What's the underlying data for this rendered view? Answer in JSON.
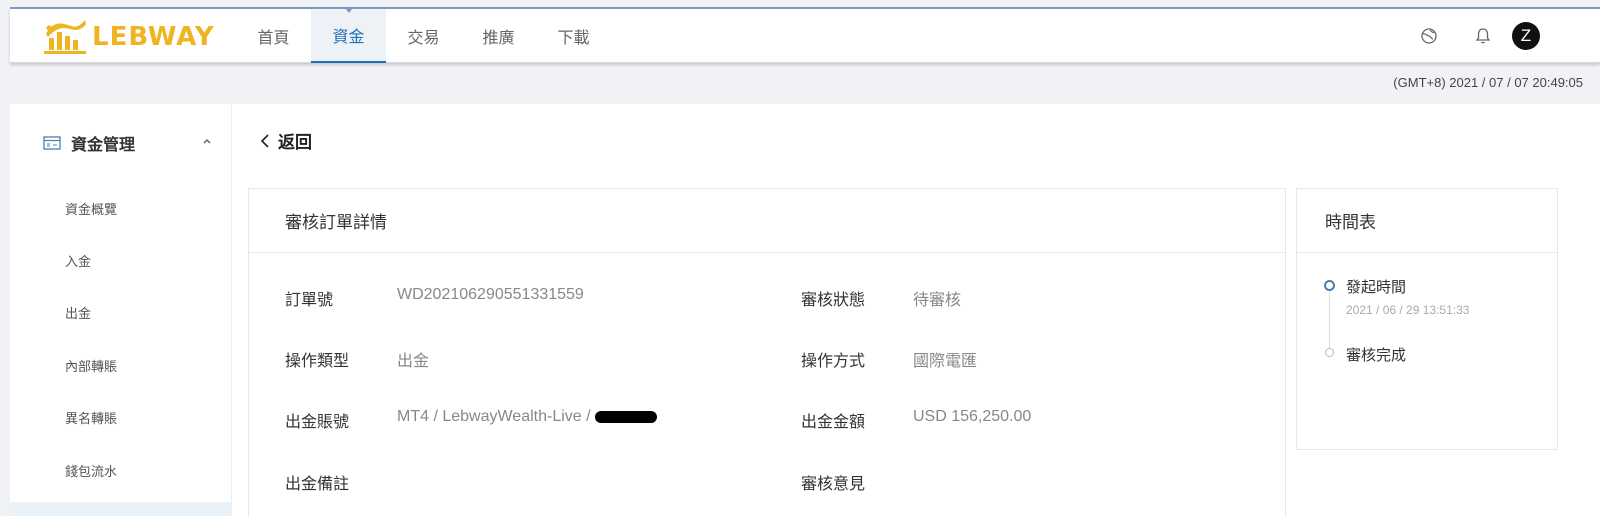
{
  "brand": {
    "name": "LEBWAY",
    "color": "#f0b322"
  },
  "nav": {
    "items": [
      {
        "label": "首頁",
        "active": false
      },
      {
        "label": "資金",
        "active": true
      },
      {
        "label": "交易",
        "active": false
      },
      {
        "label": "推廣",
        "active": false
      },
      {
        "label": "下載",
        "active": false
      }
    ]
  },
  "header": {
    "icons": [
      "globe-icon",
      "bell-icon"
    ],
    "avatar_letter": "Z",
    "clock": "(GMT+8) 2021 / 07 / 07 20:49:05"
  },
  "sidebar": {
    "section_label": "資金管理",
    "items": [
      {
        "label": "資金概覽"
      },
      {
        "label": "入金"
      },
      {
        "label": "出金"
      },
      {
        "label": "內部轉賬"
      },
      {
        "label": "異名轉賬"
      },
      {
        "label": "錢包流水"
      }
    ]
  },
  "main": {
    "back_label": "返回",
    "detail": {
      "title": "審核訂單詳情",
      "order_no_label": "訂單號",
      "order_no": "WD202106290551331559",
      "status_label": "審核狀態",
      "status": "待審核",
      "op_type_label": "操作類型",
      "op_type": "出金",
      "op_method_label": "操作方式",
      "op_method": "國際電匯",
      "account_label": "出金賬號",
      "account": "MT4 / LebwayWealth-Live /",
      "amount_label": "出金金額",
      "amount": "USD 156,250.00",
      "remark_label": "出金備註",
      "remark": "",
      "opinion_label": "審核意見",
      "opinion": ""
    },
    "timeline": {
      "title": "時間表",
      "steps": [
        {
          "label": "發起時間",
          "time": "2021 / 06 / 29 13:51:33"
        },
        {
          "label": "審核完成",
          "time": ""
        }
      ]
    }
  }
}
